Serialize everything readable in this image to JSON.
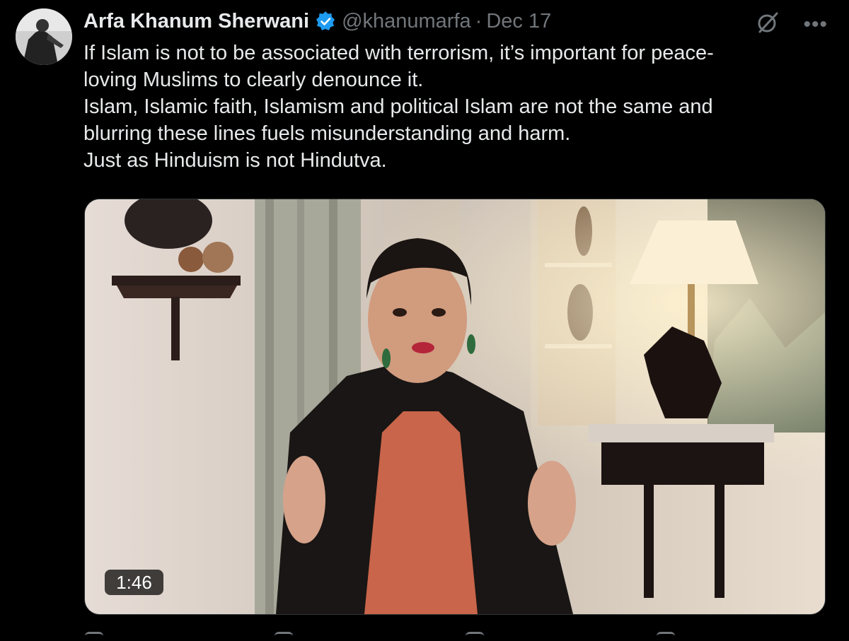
{
  "tweet": {
    "author_name": "Arfa Khanum Sherwani",
    "handle": "@khanumarfa",
    "separator": "·",
    "date": "Dec 17",
    "lines": [
      "If Islam is not to be associated with terrorism, it’s important for peace-",
      "loving Muslims to clearly denounce it.",
      "Islam, Islamic faith, Islamism and political Islam are not the same and",
      "blurring these lines fuels misunderstanding and harm.",
      "Just as Hinduism is not Hindutva."
    ],
    "more_glyph": "•••"
  },
  "media": {
    "duration": "1:46"
  },
  "icons": {
    "verified": "verified-badge-icon",
    "grok": "grok-icon",
    "more": "more-icon"
  },
  "colors": {
    "background": "#000000",
    "text": "#e7e9ea",
    "muted": "#71767b",
    "verified": "#1d9bf0"
  }
}
